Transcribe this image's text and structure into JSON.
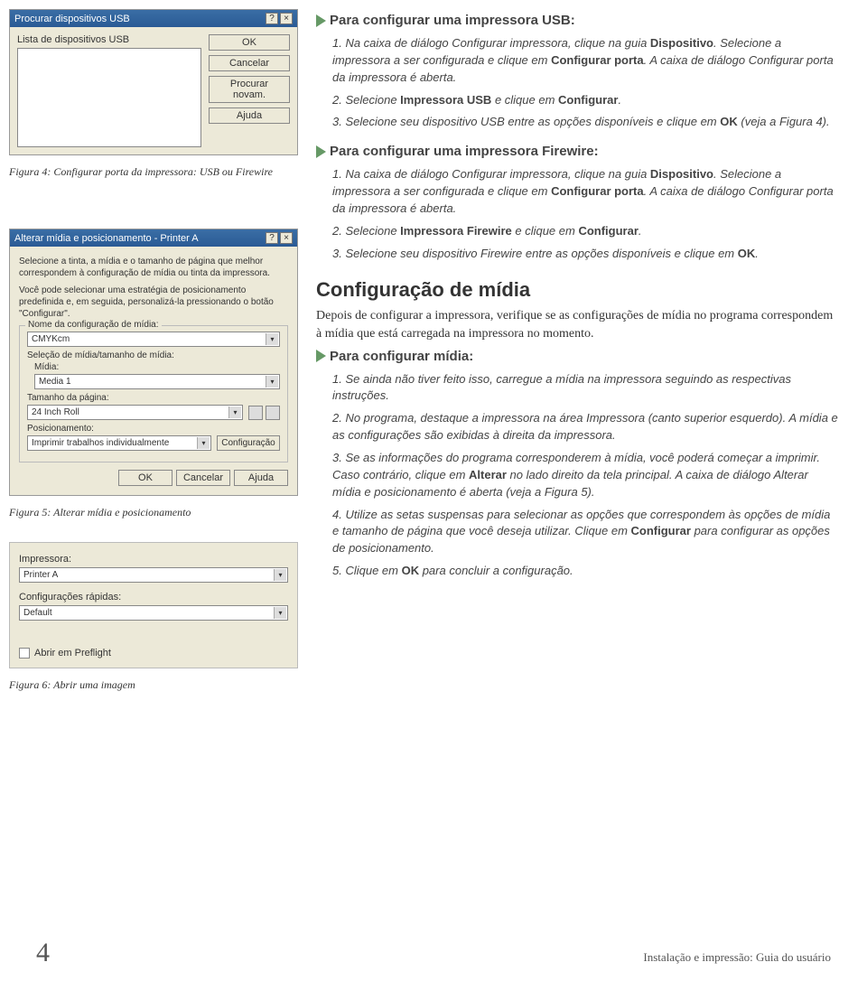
{
  "dlg1": {
    "title": "Procurar dispositivos USB",
    "list_label": "Lista de dispositivos USB",
    "btn_ok": "OK",
    "btn_cancel": "Cancelar",
    "btn_rescan": "Procurar novam.",
    "btn_help": "Ajuda"
  },
  "caption4": "Figura 4: Configurar porta da impressora: USB ou Firewire",
  "usb": {
    "heading": "Para configurar uma impressora USB:",
    "s1": "1. Na caixa de diálogo Configurar impressora, clique na guia ",
    "s1b1": "Dispositivo",
    "s1c": ". Selecione a impressora a ser configurada e clique em ",
    "s1b2": "Configurar porta",
    "s1d": ". A caixa de diálogo Configurar porta da impressora é aberta.",
    "s2": "2. Selecione ",
    "s2b": "Impressora USB",
    "s2c": " e clique em ",
    "s2b2": "Configurar",
    "s2d": ".",
    "s3": "3. Selecione seu dispositivo USB entre as opções disponíveis e clique em ",
    "s3b": "OK",
    "s3c": " (veja a Figura 4)."
  },
  "fw": {
    "heading": "Para configurar uma impressora Firewire:",
    "s1": "1. Na caixa de diálogo Configurar impressora, clique na guia ",
    "s1b1": "Dispositivo",
    "s1c": ". Selecione a impressora a ser configurada e clique em ",
    "s1b2": "Configurar porta",
    "s1d": ". A caixa de diálogo Configurar porta da impressora é aberta.",
    "s2": "2. Selecione ",
    "s2b": "Impressora Firewire",
    "s2c": " e clique em ",
    "s2b2": "Configurar",
    "s2d": ".",
    "s3": "3. Selecione seu dispositivo Firewire entre as opções disponíveis e clique em ",
    "s3b": "OK",
    "s3c": "."
  },
  "media_h": "Configuração de mídia",
  "media_para": "Depois de configurar a impressora, verifique se as configurações de mídia no programa correspondem à mídia que está carregada na impressora no momento.",
  "media_sub": "Para configurar mídia:",
  "m": {
    "s1": "1. Se ainda não tiver feito isso, carregue a mídia na impressora seguindo as respectivas instruções.",
    "s2": "2. No programa, destaque a impressora na área Impressora (canto superior esquerdo). A mídia e as configurações são exibidas à direita da impressora.",
    "s3a": "3. Se as informações do programa corresponderem à mídia, você poderá começar a imprimir. Caso contrário, clique em ",
    "s3b": "Alterar",
    "s3c": " no lado direito da tela principal. A caixa de diálogo Alterar mídia e posicionamento é aberta (veja a Figura 5).",
    "s4a": "4. Utilize as setas suspensas para selecionar as opções que correspondem às opções de mídia e tamanho de página que você deseja utilizar.  Clique em ",
    "s4b": "Configurar",
    "s4c": " para configurar as opções de posicionamento.",
    "s5a": "5. Clique em ",
    "s5b": "OK",
    "s5c": " para concluir a configuração."
  },
  "dlg2": {
    "title": "Alterar mídia e posicionamento - Printer A",
    "intro1": "Selecione a tinta, a mídia e o tamanho de página que melhor correspondem à configuração de mídia ou tinta da impressora.",
    "intro2": "Você pode selecionar uma estratégia de posicionamento predefinida e, em seguida, personalizá-la pressionando o botão \"Configurar\".",
    "grp": "Nome da configuração de mídia:",
    "grp_val": "CMYKcm",
    "sel_lbl": "Seleção de mídia/tamanho de mídia:",
    "midia_lbl": "Mídia:",
    "midia_val": "Media 1",
    "tam_lbl": "Tamanho da página:",
    "tam_val": "24 Inch Roll",
    "pos_lbl": "Posicionamento:",
    "pos_val": "Imprimir trabalhos individualmente",
    "cfg_btn": "Configuração",
    "ok": "OK",
    "cancel": "Cancelar",
    "help": "Ajuda"
  },
  "caption5": "Figura 5: Alterar mídia e posicionamento",
  "dlg3": {
    "imp_lbl": "Impressora:",
    "imp_val": "Printer A",
    "cfg_lbl": "Configurações rápidas:",
    "cfg_val": "Default",
    "chk": "Abrir em Preflight"
  },
  "caption6": "Figura 6: Abrir uma imagem",
  "page_number": "4",
  "footer_text": "Instalação e impressão: Guia do usuário"
}
